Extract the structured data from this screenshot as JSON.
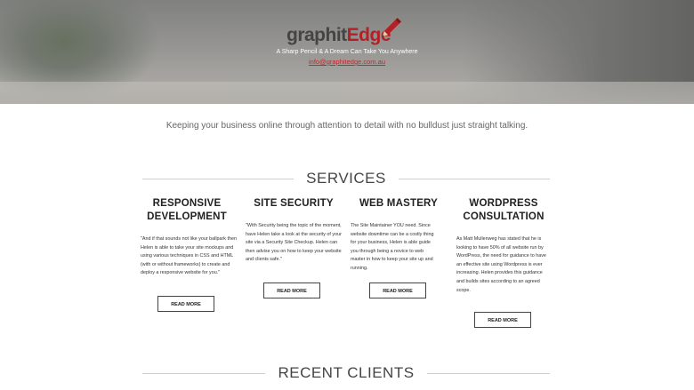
{
  "header": {
    "logo_part1": "graphit",
    "logo_part2": "Edge",
    "tagline": "A Sharp Pencil & A Dream Can Take You Anywhere",
    "email": "info@graphitedge.com.au"
  },
  "intro": "Keeping your business online through attention to detail with no bulldust just straight talking.",
  "services": {
    "heading": "SERVICES",
    "items": [
      {
        "title": "RESPONSIVE DEVELOPMENT",
        "text": "\"And if that sounds not like your ballpark then Helen is able to take your site mockups and using various techniques in CSS and HTML (with or without frameworks) to create and deploy a responsive website for you.\"",
        "button": "READ MORE"
      },
      {
        "title": "SITE SECURITY",
        "text": "\"With Security being the topic of the moment, have Helen take a look at the security of your site via a Security Site Checkup. Helen can then advise you on how to keep your website and clients safe.\"",
        "button": "READ MORE"
      },
      {
        "title": "WEB MASTERY",
        "text": "The Site Maintainer YOU need. Since website downtime can be a costly thing for your business, Helen is able guide you through being a novice to web master in how to keep your site up and running.",
        "button": "READ MORE"
      },
      {
        "title": "WORDPRESS CONSULTATION",
        "text": "As Matt Mullenweg has stated that he is looking to have 50% of all website run by WordPress, the need for guidance to have an effective site using Wordpress is ever increasing. Helen provides this guidance and builds sites according to an agreed scope.",
        "button": "READ MORE"
      }
    ]
  },
  "clients": {
    "heading": "RECENT CLIENTS"
  },
  "colors": {
    "brand_red": "#b32025",
    "logo_grey": "#444444"
  },
  "icons": {
    "logo_mark": "pencil-icon"
  }
}
